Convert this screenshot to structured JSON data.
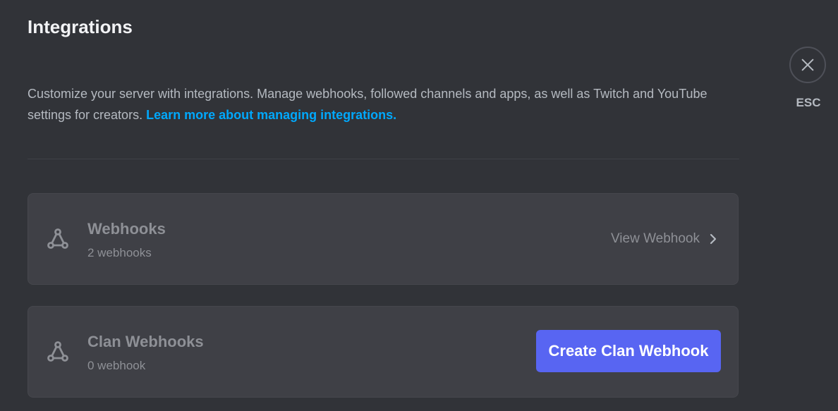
{
  "header": {
    "title": "Integrations"
  },
  "description": {
    "text": "Customize your server with integrations. Manage webhooks, followed channels and apps, as well as Twitch and YouTube settings for creators. ",
    "link": "Learn more about managing integrations."
  },
  "close": {
    "icon": "close-icon",
    "label": "ESC"
  },
  "cards": [
    {
      "icon": "webhook-icon",
      "title": "Webhooks",
      "subtitle": "2 webhooks",
      "action_label": "View Webhook",
      "action_icon": "chevron-right-icon"
    },
    {
      "icon": "webhook-icon",
      "title": "Clan Webhooks",
      "subtitle": "0 webhook",
      "action_label": "Create Clan Webhook"
    }
  ],
  "colors": {
    "background": "#313338",
    "card": "#3f4046",
    "accent": "#5865f2",
    "link": "#00a8fc"
  }
}
